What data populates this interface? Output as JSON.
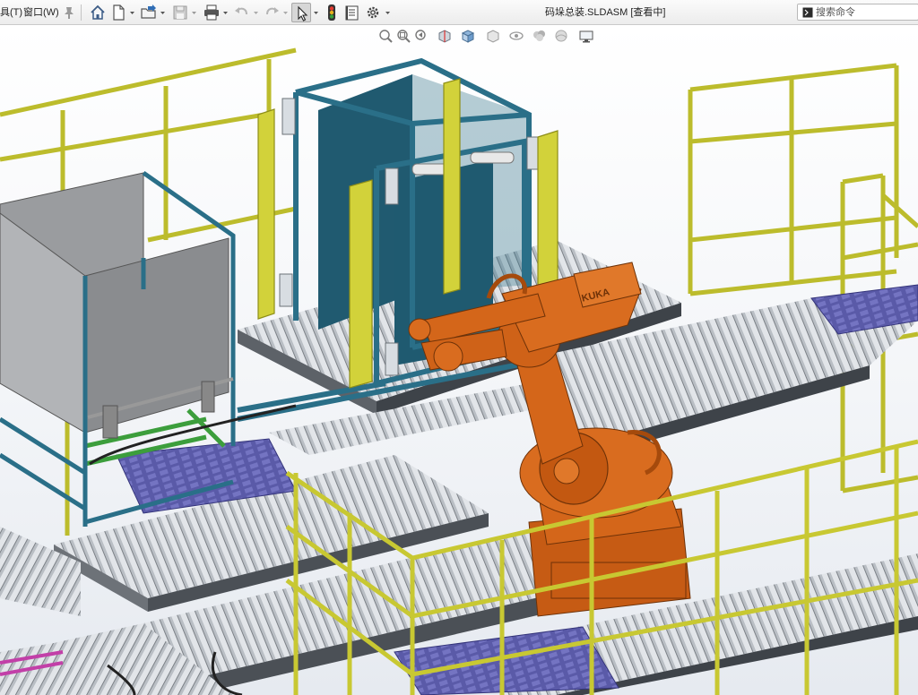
{
  "menu": {
    "tools_label": "具(T)",
    "window_label": "窗口(W)"
  },
  "window": {
    "title": "码垛总装.SLDASM [查看中]"
  },
  "search": {
    "placeholder": "搜索命令"
  },
  "toolbar": {
    "icons": [
      "pin-icon",
      "home-icon",
      "new-document-icon",
      "open-folder-icon",
      "save-icon",
      "print-icon",
      "undo-icon",
      "redo-icon",
      "select-arrow-icon",
      "rebuild-traffic-light-icon",
      "file-properties-icon",
      "options-gear-icon"
    ]
  },
  "hud": {
    "icons": [
      "zoom-to-fit-icon",
      "zoom-area-icon",
      "previous-view-icon",
      "section-view-icon",
      "view-orientation-icon",
      "display-style-icon",
      "hide-show-items-icon",
      "edit-appearance-icon",
      "apply-scene-icon",
      "view-settings-icon"
    ]
  },
  "model": {
    "robot_brand": "KUKA",
    "colors": {
      "robot_orange": "#d4661a",
      "fence_yellow": "#c8c832",
      "frame_blue": "#2a6f88",
      "pallet_purple": "#5a5aa8",
      "roller_grey": "#c9cdd3",
      "panel_grey": "#8d8f92"
    }
  }
}
